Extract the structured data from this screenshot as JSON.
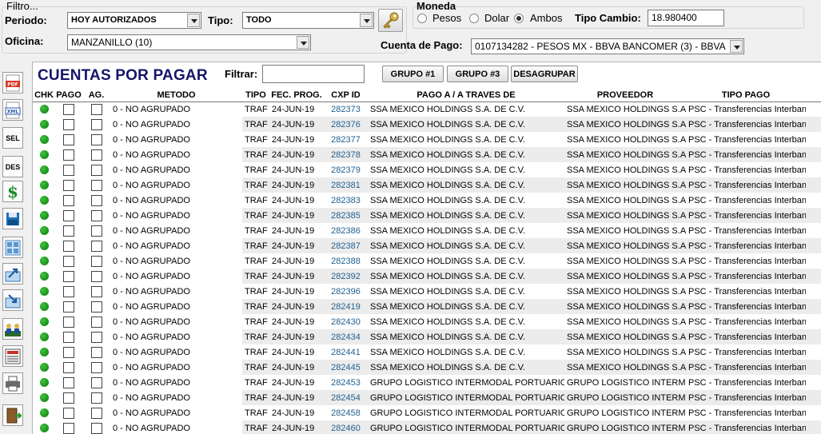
{
  "filter": {
    "heading": "Filtro...",
    "periodo_label": "Periodo:",
    "periodo_value": "HOY AUTORIZADOS",
    "tipo_label": "Tipo:",
    "tipo_value": "TODO",
    "oficina_label": "Oficina:",
    "oficina_value": "MANZANILLO (10)"
  },
  "moneda": {
    "heading": "Moneda",
    "options": [
      "Pesos",
      "Dolar",
      "Ambos"
    ],
    "selected": "Ambos",
    "tipo_cambio_label": "Tipo Cambio:",
    "tipo_cambio_value": "18.980400",
    "cuenta_label": "Cuenta de Pago:",
    "cuenta_value": "0107134282 - PESOS MX - BBVA BANCOMER (3) - BBVA"
  },
  "toolbar": {
    "items": [
      {
        "icon": "pdf-icon",
        "text": "PDF"
      },
      {
        "icon": "xml-icon",
        "text": "XML"
      },
      {
        "icon": "select-all-icon",
        "text": "SEL"
      },
      {
        "icon": "deselect-icon",
        "text": "DES"
      },
      {
        "icon": "dollar-icon",
        "text": "$"
      },
      {
        "icon": "save-icon",
        "text": ""
      },
      {
        "icon": "grid-icon",
        "text": ""
      },
      {
        "icon": "export-icon",
        "text": ""
      },
      {
        "icon": "import-icon",
        "text": ""
      },
      {
        "icon": "users-icon",
        "text": ""
      },
      {
        "icon": "report-icon",
        "text": ""
      },
      {
        "icon": "print-icon",
        "text": ""
      },
      {
        "icon": "exit-icon",
        "text": ""
      }
    ]
  },
  "main": {
    "title": "CUENTAS POR PAGAR",
    "filtrar_label": "Filtrar:",
    "filtrar_value": "",
    "buttons": [
      "GRUPO #1",
      "GRUPO #3",
      "DESAGRUPAR"
    ]
  },
  "table": {
    "columns": [
      "CHK",
      "PAGO",
      "AG.",
      "METODO",
      "TIPO",
      "FEC. PROG.",
      "CXP ID",
      "PAGO A / A TRAVES DE",
      "PROVEEDOR",
      "TIPO PAGO"
    ],
    "rows": [
      {
        "metodo": "0 - NO AGRUPADO",
        "tipo": "TRAF",
        "fecha": "24-JUN-19",
        "cxp": "282373",
        "pago_a": "SSA MEXICO HOLDINGS S.A. DE C.V.",
        "proveedor": "SSA MEXICO HOLDINGS S.A. DE",
        "tipo_pago": "PSC - Transferencias Interbanc"
      },
      {
        "metodo": "0 - NO AGRUPADO",
        "tipo": "TRAF",
        "fecha": "24-JUN-19",
        "cxp": "282376",
        "pago_a": "SSA MEXICO HOLDINGS S.A. DE C.V.",
        "proveedor": "SSA MEXICO HOLDINGS S.A. DE",
        "tipo_pago": "PSC - Transferencias Interbanc"
      },
      {
        "metodo": "0 - NO AGRUPADO",
        "tipo": "TRAF",
        "fecha": "24-JUN-19",
        "cxp": "282377",
        "pago_a": "SSA MEXICO HOLDINGS S.A. DE C.V.",
        "proveedor": "SSA MEXICO HOLDINGS S.A. DE",
        "tipo_pago": "PSC - Transferencias Interbanc"
      },
      {
        "metodo": "0 - NO AGRUPADO",
        "tipo": "TRAF",
        "fecha": "24-JUN-19",
        "cxp": "282378",
        "pago_a": "SSA MEXICO HOLDINGS S.A. DE C.V.",
        "proveedor": "SSA MEXICO HOLDINGS S.A. DE",
        "tipo_pago": "PSC - Transferencias Interbanc"
      },
      {
        "metodo": "0 - NO AGRUPADO",
        "tipo": "TRAF",
        "fecha": "24-JUN-19",
        "cxp": "282379",
        "pago_a": "SSA MEXICO HOLDINGS S.A. DE C.V.",
        "proveedor": "SSA MEXICO HOLDINGS S.A. DE",
        "tipo_pago": "PSC - Transferencias Interbanc"
      },
      {
        "metodo": "0 - NO AGRUPADO",
        "tipo": "TRAF",
        "fecha": "24-JUN-19",
        "cxp": "282381",
        "pago_a": "SSA MEXICO HOLDINGS S.A. DE C.V.",
        "proveedor": "SSA MEXICO HOLDINGS S.A. DE",
        "tipo_pago": "PSC - Transferencias Interbanc"
      },
      {
        "metodo": "0 - NO AGRUPADO",
        "tipo": "TRAF",
        "fecha": "24-JUN-19",
        "cxp": "282383",
        "pago_a": "SSA MEXICO HOLDINGS S.A. DE C.V.",
        "proveedor": "SSA MEXICO HOLDINGS S.A. DE",
        "tipo_pago": "PSC - Transferencias Interbanc"
      },
      {
        "metodo": "0 - NO AGRUPADO",
        "tipo": "TRAF",
        "fecha": "24-JUN-19",
        "cxp": "282385",
        "pago_a": "SSA MEXICO HOLDINGS S.A. DE C.V.",
        "proveedor": "SSA MEXICO HOLDINGS S.A. DE",
        "tipo_pago": "PSC - Transferencias Interbanc"
      },
      {
        "metodo": "0 - NO AGRUPADO",
        "tipo": "TRAF",
        "fecha": "24-JUN-19",
        "cxp": "282386",
        "pago_a": "SSA MEXICO HOLDINGS S.A. DE C.V.",
        "proveedor": "SSA MEXICO HOLDINGS S.A. DE",
        "tipo_pago": "PSC - Transferencias Interbanc"
      },
      {
        "metodo": "0 - NO AGRUPADO",
        "tipo": "TRAF",
        "fecha": "24-JUN-19",
        "cxp": "282387",
        "pago_a": "SSA MEXICO HOLDINGS S.A. DE C.V.",
        "proveedor": "SSA MEXICO HOLDINGS S.A. DE",
        "tipo_pago": "PSC - Transferencias Interbanc"
      },
      {
        "metodo": "0 - NO AGRUPADO",
        "tipo": "TRAF",
        "fecha": "24-JUN-19",
        "cxp": "282388",
        "pago_a": "SSA MEXICO HOLDINGS S.A. DE C.V.",
        "proveedor": "SSA MEXICO HOLDINGS S.A. DE",
        "tipo_pago": "PSC - Transferencias Interbanc"
      },
      {
        "metodo": "0 - NO AGRUPADO",
        "tipo": "TRAF",
        "fecha": "24-JUN-19",
        "cxp": "282392",
        "pago_a": "SSA MEXICO HOLDINGS S.A. DE C.V.",
        "proveedor": "SSA MEXICO HOLDINGS S.A. DE",
        "tipo_pago": "PSC - Transferencias Interbanc"
      },
      {
        "metodo": "0 - NO AGRUPADO",
        "tipo": "TRAF",
        "fecha": "24-JUN-19",
        "cxp": "282396",
        "pago_a": "SSA MEXICO HOLDINGS S.A. DE C.V.",
        "proveedor": "SSA MEXICO HOLDINGS S.A. DE",
        "tipo_pago": "PSC - Transferencias Interbanc"
      },
      {
        "metodo": "0 - NO AGRUPADO",
        "tipo": "TRAF",
        "fecha": "24-JUN-19",
        "cxp": "282419",
        "pago_a": "SSA MEXICO HOLDINGS S.A. DE C.V.",
        "proveedor": "SSA MEXICO HOLDINGS S.A. DE",
        "tipo_pago": "PSC - Transferencias Interbanc"
      },
      {
        "metodo": "0 - NO AGRUPADO",
        "tipo": "TRAF",
        "fecha": "24-JUN-19",
        "cxp": "282430",
        "pago_a": "SSA MEXICO HOLDINGS S.A. DE C.V.",
        "proveedor": "SSA MEXICO HOLDINGS S.A. DE",
        "tipo_pago": "PSC - Transferencias Interbanc"
      },
      {
        "metodo": "0 - NO AGRUPADO",
        "tipo": "TRAF",
        "fecha": "24-JUN-19",
        "cxp": "282434",
        "pago_a": "SSA MEXICO HOLDINGS S.A. DE C.V.",
        "proveedor": "SSA MEXICO HOLDINGS S.A. DE",
        "tipo_pago": "PSC - Transferencias Interbanc"
      },
      {
        "metodo": "0 - NO AGRUPADO",
        "tipo": "TRAF",
        "fecha": "24-JUN-19",
        "cxp": "282441",
        "pago_a": "SSA MEXICO HOLDINGS S.A. DE C.V.",
        "proveedor": "SSA MEXICO HOLDINGS S.A. DE",
        "tipo_pago": "PSC - Transferencias Interbanc"
      },
      {
        "metodo": "0 - NO AGRUPADO",
        "tipo": "TRAF",
        "fecha": "24-JUN-19",
        "cxp": "282445",
        "pago_a": "SSA MEXICO HOLDINGS S.A. DE C.V.",
        "proveedor": "SSA MEXICO HOLDINGS S.A. DE",
        "tipo_pago": "PSC - Transferencias Interbanc"
      },
      {
        "metodo": "0 - NO AGRUPADO",
        "tipo": "TRAF",
        "fecha": "24-JUN-19",
        "cxp": "282453",
        "pago_a": "GRUPO LOGISTICO INTERMODAL PORTUARIO, S.A",
        "proveedor": "GRUPO LOGISTICO INTERMODAL",
        "tipo_pago": "PSC - Transferencias Interbanc"
      },
      {
        "metodo": "0 - NO AGRUPADO",
        "tipo": "TRAF",
        "fecha": "24-JUN-19",
        "cxp": "282454",
        "pago_a": "GRUPO LOGISTICO INTERMODAL PORTUARIO, S.A",
        "proveedor": "GRUPO LOGISTICO INTERMODAL",
        "tipo_pago": "PSC - Transferencias Interbanc"
      },
      {
        "metodo": "0 - NO AGRUPADO",
        "tipo": "TRAF",
        "fecha": "24-JUN-19",
        "cxp": "282458",
        "pago_a": "GRUPO LOGISTICO INTERMODAL PORTUARIO, S.A",
        "proveedor": "GRUPO LOGISTICO INTERMODAL",
        "tipo_pago": "PSC - Transferencias Interbanc"
      },
      {
        "metodo": "0 - NO AGRUPADO",
        "tipo": "TRAF",
        "fecha": "24-JUN-19",
        "cxp": "282460",
        "pago_a": "GRUPO LOGISTICO INTERMODAL PORTUARIO, S.A",
        "proveedor": "GRUPO LOGISTICO INTERMODAL",
        "tipo_pago": "PSC - Transferencias Interbanc"
      }
    ]
  }
}
